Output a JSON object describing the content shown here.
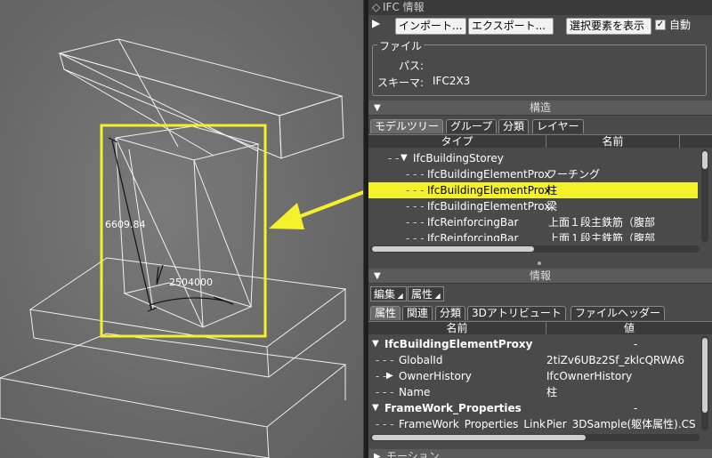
{
  "viewport": {
    "dim_height": "6609.84",
    "dim_width": "2504000"
  },
  "panel": {
    "title": "IFC 情報",
    "toolbar": {
      "import_label": "インポート...",
      "export_label": "エクスポート...",
      "show_selected_label": "選択要素を表示",
      "auto_label": "自動",
      "auto_checked": true
    },
    "file": {
      "group_label": "ファイル",
      "path_label": "パス:",
      "path_value": "",
      "schema_label": "スキーマ:",
      "schema_value": "IFC2X3"
    },
    "structure": {
      "title": "構造",
      "tabs": [
        "モデルツリー",
        "グループ",
        "分類",
        "レイヤー"
      ],
      "columns": [
        "タイプ",
        "名前"
      ],
      "rows": [
        {
          "type": "IfcBuildingStorey",
          "name": ""
        },
        {
          "type": "IfcBuildingElementProx",
          "name": "フーチング"
        },
        {
          "type": "IfcBuildingElementProx",
          "name": "柱"
        },
        {
          "type": "IfcBuildingElementProx",
          "name": "梁"
        },
        {
          "type": "IfcReinforcingBar",
          "name": "上面１段主鉄筋（腹部"
        },
        {
          "type": "IfcReinforcingBar",
          "name": "上面１段主鉄筋（腹部"
        }
      ],
      "selected_index": 2
    },
    "info": {
      "title": "情報",
      "buttons": [
        "編集",
        "属性"
      ],
      "tabs": [
        "属性",
        "関連",
        "分類",
        "3Dアトリビュート",
        "ファイルヘッダー"
      ],
      "columns": [
        "名前",
        "値"
      ],
      "rows": [
        {
          "name": "IfcBuildingElementProxy",
          "value": "-"
        },
        {
          "name": "GlobalId",
          "value": "2tiZv6UBz2Sf_zklcQRWA6"
        },
        {
          "name": "OwnerHistory",
          "value": "IfcOwnerHistory"
        },
        {
          "name": "Name",
          "value": "柱"
        },
        {
          "name": "FrameWork_Properties",
          "value": "-"
        },
        {
          "name": "FrameWork_Properties_Link",
          "value": "Pier_3DSample(躯体属性).CS"
        }
      ]
    },
    "next_section_title": "モーション"
  },
  "colors": {
    "highlight": "#f4f12a",
    "wireframe": "#ffffff",
    "selection_box": "#f4f12a"
  }
}
